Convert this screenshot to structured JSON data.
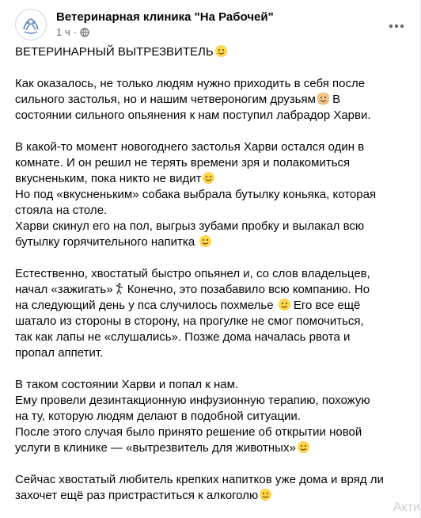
{
  "post": {
    "page_name": "Ветеринарная клиника \"На Рабочей\"",
    "time": "1 ч",
    "separator": "·",
    "privacy_icon": "globe-icon",
    "more_icon": "more-options-icon",
    "paragraphs": [
      {
        "lines": [
          {
            "text": "ВЕТЕРИНАРНЫЙ ВЫТРЕЗВИТЕЛЬ",
            "emoji": "laughing-face-emoji"
          }
        ]
      },
      {
        "lines": [
          {
            "text": "Как оказалось, не только людям нужно приходить в себя после"
          },
          {
            "text": "сильного застолья, но и нашим четвероногим друзьям",
            "emoji": "dog-face-emoji",
            "after": " В"
          },
          {
            "text": "состоянии сильного опьянения к нам поступил лабрадор Харви."
          }
        ]
      },
      {
        "lines": [
          {
            "text": "В какой-то момент новогоднего застолья Харви остался один в"
          },
          {
            "text": "комнате. И он решил не терять времени зря и полакомиться"
          },
          {
            "text": "вкусненьким, пока никто не видит",
            "emoji": "yum-face-emoji"
          },
          {
            "text": "Но под «вкусненьким» собака выбрала бутылку коньяка, которая"
          },
          {
            "text": "стояла на столе."
          },
          {
            "text": "Харви скинул его на пол,  выгрыз зубами пробку и вылакал всю"
          },
          {
            "text": "бутылку горячительного напитка ",
            "emoji": "grinning-face-emoji"
          }
        ]
      },
      {
        "lines": [
          {
            "text": "Естественно, хвостатый быстро опьянел и, со слов владельцев,"
          },
          {
            "text": "начал «зажигать»",
            "emoji": "dancing-man-emoji",
            "after": " Конечно, это позабавило всю компанию. Но"
          },
          {
            "text": "на следующий день у пса случилось похмелье ",
            "emoji": "hushed-face-emoji",
            "after": " Его все ещё"
          },
          {
            "text": "шатало из стороны в сторону, на прогулке не смог помочиться,"
          },
          {
            "text": "так как лапы не «слушались». Позже дома началась рвота и"
          },
          {
            "text": "пропал аппетит."
          }
        ]
      },
      {
        "lines": [
          {
            "text": "В таком состоянии Харви и попал к нам."
          },
          {
            "text": "Ему провели дезинтакционную инфузионную терапию, похожую"
          },
          {
            "text": "на ту, которую людям делают в подобной ситуации."
          },
          {
            "text": "После этого случая было принято решение об открытии новой"
          },
          {
            "text": "услуги в клинике —  «вытрезвитель для животных»",
            "emoji": "laughing-face-emoji"
          }
        ]
      },
      {
        "lines": [
          {
            "text": "Сейчас хвостатый любитель крепких напитков уже дома и вряд ли"
          },
          {
            "text": "захочет ещё раз пристраститься к алкоголю",
            "emoji": "wink-face-emoji"
          }
        ]
      }
    ]
  },
  "watermark": "Акти"
}
